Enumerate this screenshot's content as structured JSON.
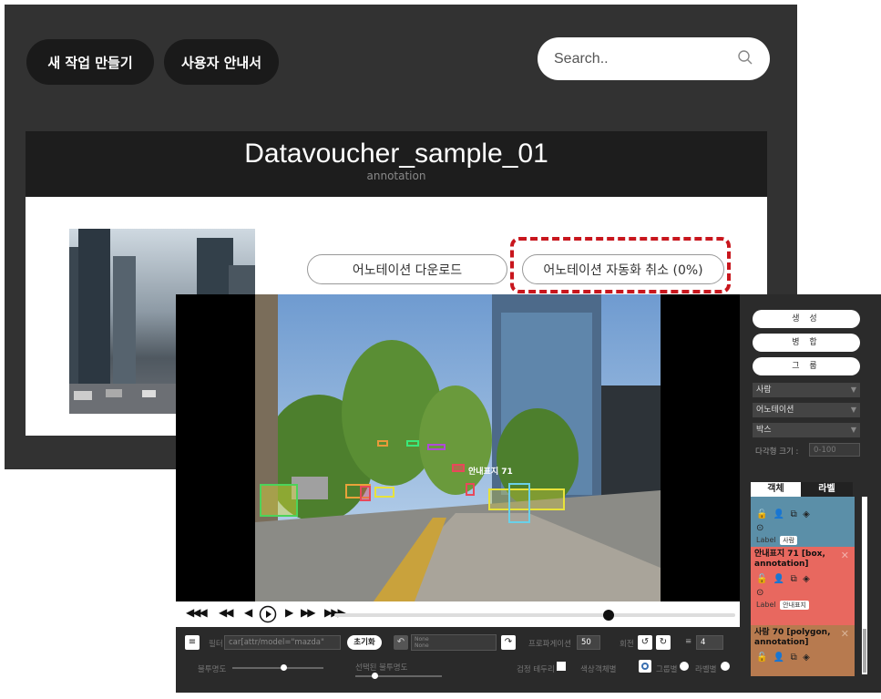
{
  "app": {
    "new_task_button": "새 작업 만들기",
    "user_guide_button": "사용자 안내서",
    "search_placeholder": "Search..",
    "project_title": "Datavoucher_sample_01",
    "project_subtitle": "annotation",
    "download_button": "어노테이션 다운로드",
    "cancel_auto_button": "어노테이션 자동화 취소 (0%)"
  },
  "tool": {
    "frame_labels": {
      "sign_label": "안내표지 71"
    },
    "playback": {
      "rewind_fast": "◀◀◀",
      "rewind": "◀◀",
      "step_back": "◀",
      "play": "▶",
      "step_fwd": "▶",
      "fwd": "▶▶",
      "fwd_fast": "▶▶▶",
      "position": 0.68
    },
    "bottom": {
      "filter_label": "필터",
      "filter_value": "car[attr/model=\"mazda\"",
      "reset_button": "초기화",
      "none_1": "None",
      "none_2": "None",
      "propagation_label": "프로파게이션",
      "propagation_value": "50",
      "rotation_label": "회전",
      "step_value": "4",
      "opacity_label": "불투명도",
      "selected_opacity_label": "선택된 불투명도",
      "outline_label": "검정 테두리",
      "color_label": "색상",
      "color_instance": "객체별",
      "color_group": "그룹별",
      "color_label_opt": "라벨별"
    },
    "right": {
      "create_button": "생 성",
      "merge_button": "병 합",
      "group_button": "그 룹",
      "select_person": "사람",
      "select_mode": "어노테이션",
      "select_shape": "박스",
      "polygon_size_label": "다각형 크기 :",
      "polygon_size_placeholder": "0-100",
      "tab_objects": "객체",
      "tab_labels": "라벨",
      "card1_label": "Label",
      "card1_chip": "사람",
      "card2_title": "안내표지 71 [box, annotation]",
      "card2_label": "Label",
      "card2_chip": "안내표지",
      "card3_title": "사람 70 [polygon, annotation]"
    }
  },
  "colors": {
    "accent_red": "#c8161d",
    "card_blue": "#5b8fa8",
    "card_red": "#e8685f",
    "card_brown": "#b77a4f"
  }
}
